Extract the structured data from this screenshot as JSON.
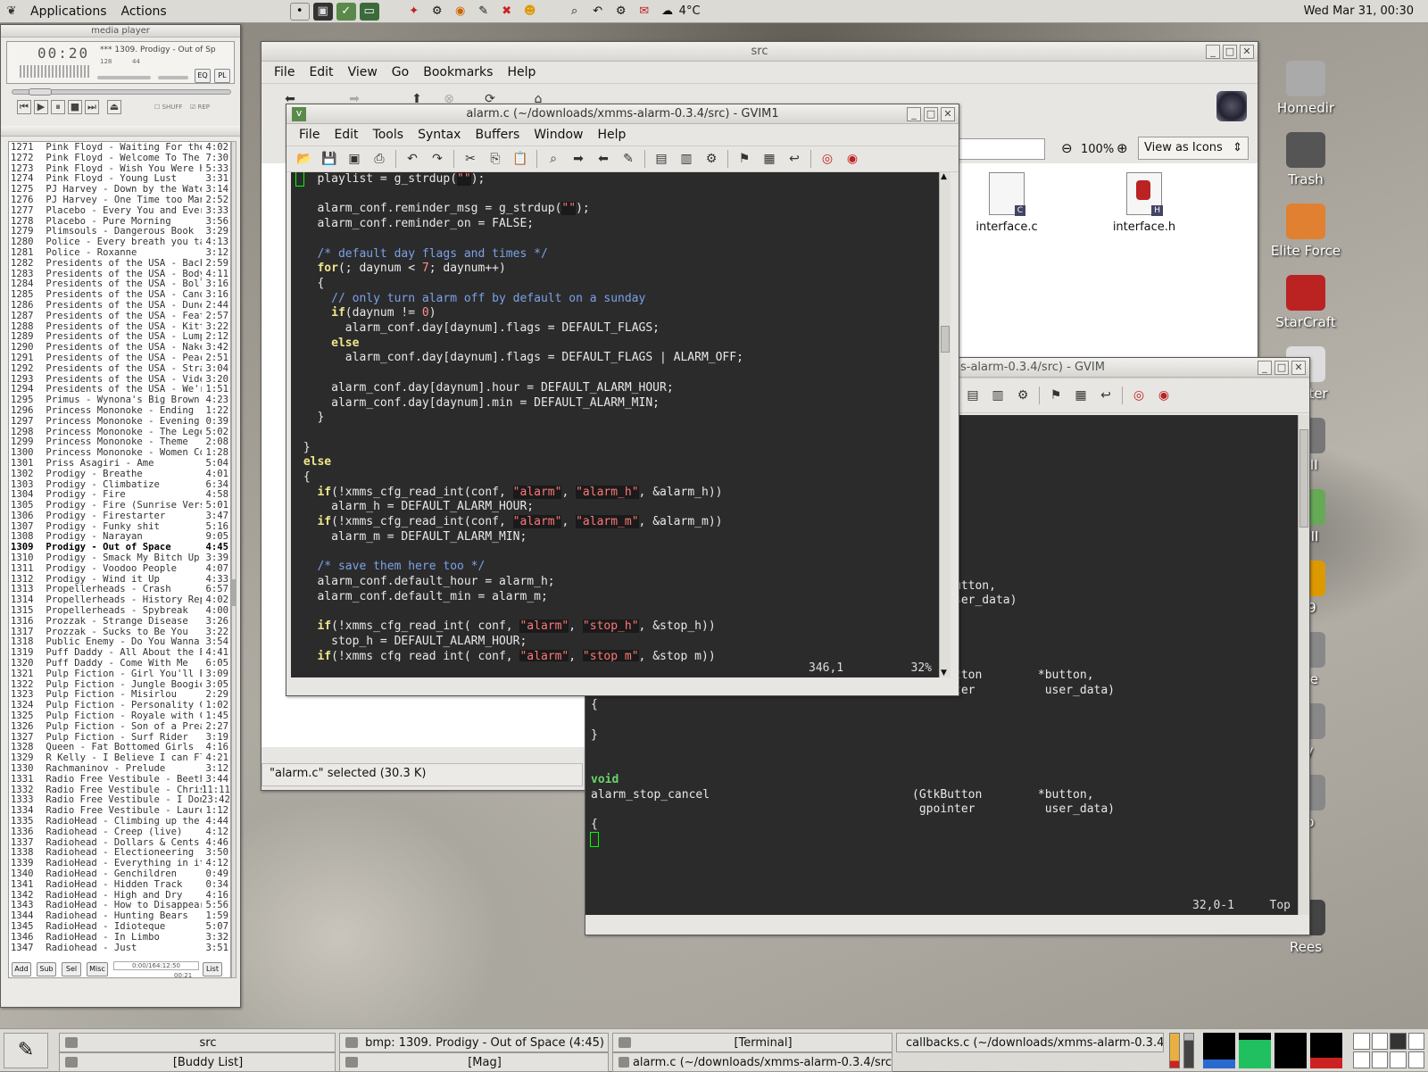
{
  "panel": {
    "applications": "Applications",
    "actions": "Actions",
    "weather": "4°C",
    "clock": "Wed Mar 31, 00:30"
  },
  "media_player": {
    "title": "media player",
    "time": "00:20",
    "song": "*** 1309. Prodigy - Out of Sp",
    "kbps": "128",
    "khz": "44",
    "shuff": "SHUFF",
    "rep": "REP",
    "eq": "EQ",
    "pl": "PL"
  },
  "playlist": {
    "items": [
      [
        "1271",
        "Pink Floyd - Waiting For the Wor",
        "4:02"
      ],
      [
        "1272",
        "Pink Floyd - Welcome To The Ma",
        "7:30"
      ],
      [
        "1273",
        "Pink Floyd - Wish You Were Here",
        "5:33"
      ],
      [
        "1274",
        "Pink Floyd - Young Lust",
        "3:31"
      ],
      [
        "1275",
        "PJ Harvey - Down by the Water",
        "3:14"
      ],
      [
        "1276",
        "PJ Harvey - One Time too Many",
        "2:52"
      ],
      [
        "1277",
        "Placebo - Every You and Every M",
        "3:33"
      ],
      [
        "1278",
        "Placebo - Pure Morning",
        "3:56"
      ],
      [
        "1279",
        "Plimsouls - Dangerous Book",
        "3:29"
      ],
      [
        "1280",
        "Police - Every breath you take",
        "4:13"
      ],
      [
        "1281",
        "Police - Roxanne",
        "3:12"
      ],
      [
        "1282",
        "Presidents of the USA - Back Po",
        "2:59"
      ],
      [
        "1283",
        "Presidents of the USA - Body",
        "4:11"
      ],
      [
        "1284",
        "Presidents of the USA - Boll We",
        "3:16"
      ],
      [
        "1285",
        "Presidents of the USA - Candy",
        "3:16"
      ],
      [
        "1286",
        "Presidents of the USA - Dune Bu",
        "2:44"
      ],
      [
        "1287",
        "Presidents of the USA - Feather",
        "2:57"
      ],
      [
        "1288",
        "Presidents of the USA - Kitty",
        "3:22"
      ],
      [
        "1289",
        "Presidents of the USA - Lump",
        "2:12"
      ],
      [
        "1290",
        "Presidents of the USA - Naked A",
        "3:42"
      ],
      [
        "1291",
        "Presidents of the USA - Peache",
        "2:51"
      ],
      [
        "1292",
        "Presidents of the USA - Strange",
        "3:04"
      ],
      [
        "1293",
        "Presidents of the USA - Video K",
        "3:20"
      ],
      [
        "1294",
        "Presidents of the USA - We're n",
        "1:51"
      ],
      [
        "1295",
        "Primus - Wynona's Big Brown Be",
        "4:23"
      ],
      [
        "1296",
        "Princess Mononoke - Ending",
        "1:22"
      ],
      [
        "1297",
        "Princess Mononoke - Evening at",
        "0:39"
      ],
      [
        "1298",
        "Princess Mononoke - The Legen",
        "5:02"
      ],
      [
        "1299",
        "Princess Mononoke - Theme",
        "2:08"
      ],
      [
        "1300",
        "Princess Mononoke - Women Co",
        "1:28"
      ],
      [
        "1301",
        "Priss Asagiri - Ame",
        "5:04"
      ],
      [
        "1302",
        "Prodigy - Breathe",
        "4:01"
      ],
      [
        "1303",
        "Prodigy - Climbatize",
        "6:34"
      ],
      [
        "1304",
        "Prodigy - Fire",
        "4:58"
      ],
      [
        "1305",
        "Prodigy - Fire (Sunrise Version)",
        "5:01"
      ],
      [
        "1306",
        "Prodigy - Firestarter",
        "3:47"
      ],
      [
        "1307",
        "Prodigy - Funky shit",
        "5:16"
      ],
      [
        "1308",
        "Prodigy - Narayan",
        "9:05"
      ],
      [
        "1309",
        "Prodigy - Out of Space",
        "4:45"
      ],
      [
        "1310",
        "Prodigy - Smack My Bitch Up",
        "3:39"
      ],
      [
        "1311",
        "Prodigy - Voodoo People",
        "4:07"
      ],
      [
        "1312",
        "Prodigy - Wind it Up",
        "4:33"
      ],
      [
        "1313",
        "Propellerheads - Crash",
        "6:57"
      ],
      [
        "1314",
        "Propellerheads - History Repeat",
        "4:02"
      ],
      [
        "1315",
        "Propellerheads - Spybreak",
        "4:00"
      ],
      [
        "1316",
        "Prozzak - Strange Disease",
        "3:26"
      ],
      [
        "1317",
        "Prozzak - Sucks to Be You",
        "3:22"
      ],
      [
        "1318",
        "Public Enemy - Do You Wanna G",
        "3:54"
      ],
      [
        "1319",
        "Puff Daddy - All About the Benja",
        "4:41"
      ],
      [
        "1320",
        "Puff Daddy - Come With Me",
        "6:05"
      ],
      [
        "1321",
        "Pulp Fiction - Girl You'll Be a Wo",
        "3:09"
      ],
      [
        "1322",
        "Pulp Fiction - Jungle Boogie",
        "3:05"
      ],
      [
        "1323",
        "Pulp Fiction - Misirlou",
        "2:29"
      ],
      [
        "1324",
        "Pulp Fiction - Personality Goes",
        "1:02"
      ],
      [
        "1325",
        "Pulp Fiction - Royale with Chees",
        "1:45"
      ],
      [
        "1326",
        "Pulp Fiction - Son of a Preacher",
        "2:27"
      ],
      [
        "1327",
        "Pulp Fiction - Surf Rider",
        "3:19"
      ],
      [
        "1328",
        "Queen - Fat Bottomed Girls",
        "4:16"
      ],
      [
        "1329",
        "R Kelly - I Believe I can Fly",
        "4:21"
      ],
      [
        "1330",
        "Rachmaninov - Prelude",
        "3:12"
      ],
      [
        "1331",
        "Radio Free Vestibule - Beethove",
        "3:44"
      ],
      [
        "1332",
        "Radio Free Vestibule - Christma",
        "11:11"
      ],
      [
        "1333",
        "Radio Free Vestibule - I Don't W",
        "23:42"
      ],
      [
        "1334",
        "Radio Free Vestibule - Laurence",
        "1:12"
      ],
      [
        "1335",
        "RadioHead - Climbing up the Wa",
        "4:44"
      ],
      [
        "1336",
        "Radiohead - Creep (live)",
        "4:12"
      ],
      [
        "1337",
        "Radiohead - Dollars & Cents",
        "4:46"
      ],
      [
        "1338",
        "Radiohead - Electioneering",
        "3:50"
      ],
      [
        "1339",
        "RadioHead - Everything in its Ri",
        "4:12"
      ],
      [
        "1340",
        "RadioHead - Genchildren",
        "0:49"
      ],
      [
        "1341",
        "RadioHead - Hidden Track",
        "0:34"
      ],
      [
        "1342",
        "RadioHead - High and Dry",
        "4:16"
      ],
      [
        "1343",
        "RadioHead - How to Disappear C",
        "5:56"
      ],
      [
        "1344",
        "Radiohead - Hunting Bears",
        "1:59"
      ],
      [
        "1345",
        "RadioHead - Idioteque",
        "5:07"
      ],
      [
        "1346",
        "RadioHead - In Limbo",
        "3:32"
      ],
      [
        "1347",
        "Radiohead - Just",
        "3:51"
      ]
    ],
    "current": "1309",
    "add": "Add",
    "sub": "Sub",
    "sel": "Sel",
    "misc": "Misc",
    "list": "List",
    "counter": "0:00/164:12:50",
    "mini_time": "00:21"
  },
  "src_window": {
    "title": "src",
    "menu": [
      "File",
      "Edit",
      "View",
      "Go",
      "Bookmarks",
      "Help"
    ],
    "zoom": "100%",
    "view_as": "View as Icons",
    "status": "\"alarm.c\" selected (30.3 K)",
    "files": [
      "interface.c",
      "interface.h"
    ]
  },
  "gvim_front": {
    "title": "alarm.c (~/downloads/xmms-alarm-0.3.4/src) - GVIM1",
    "menu": [
      "File",
      "Edit",
      "Tools",
      "Syntax",
      "Buffers",
      "Window",
      "Help"
    ],
    "position": "346,1",
    "percent": "32%"
  },
  "gvim_back": {
    "title": "s-alarm-0.3.4/src) - GVIM",
    "position": "32,0-1",
    "percent": "Top"
  },
  "desktop": {
    "icons": [
      "Homedir",
      "Trash",
      "Elite Force",
      "StarCraft",
      "Winter",
      "e III",
      "ft III",
      "e 9",
      "ode",
      "ky",
      "ep",
      "Rees"
    ]
  },
  "taskbar": {
    "tasks": [
      "src",
      "bmp: 1309. Prodigy - Out of Space (4:45)",
      "[Terminal]",
      "callbacks.c (~/downloads/xmms-alarm-0.3.4",
      "[Buddy List]",
      "[Mag]",
      "alarm.c (~/downloads/xmms-alarm-0.3.4/src"
    ]
  }
}
